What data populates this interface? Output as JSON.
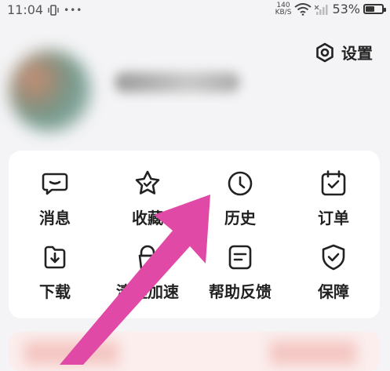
{
  "status_bar": {
    "time": "11:04",
    "ellipsis": "•••",
    "net_speed_value": "140",
    "net_speed_unit": "KB/S",
    "battery_percent": "53%",
    "battery_level": 0.53
  },
  "header": {
    "settings_label": "设置",
    "settings_icon": "hexagon-settings-icon"
  },
  "menu": {
    "items": [
      {
        "label": "消息",
        "icon": "message-icon"
      },
      {
        "label": "收藏",
        "icon": "star-icon"
      },
      {
        "label": "历史",
        "icon": "clock-icon"
      },
      {
        "label": "订单",
        "icon": "calendar-check-icon"
      },
      {
        "label": "下载",
        "icon": "download-icon"
      },
      {
        "label": "清理加速",
        "icon": "cleanup-icon"
      },
      {
        "label": "帮助反馈",
        "icon": "feedback-icon"
      },
      {
        "label": "保障",
        "icon": "shield-check-icon"
      }
    ]
  },
  "colors": {
    "arrow": "#e04aa6",
    "text": "#222222",
    "card_bg": "#ffffff",
    "page_bg": "#f4f4f6"
  }
}
